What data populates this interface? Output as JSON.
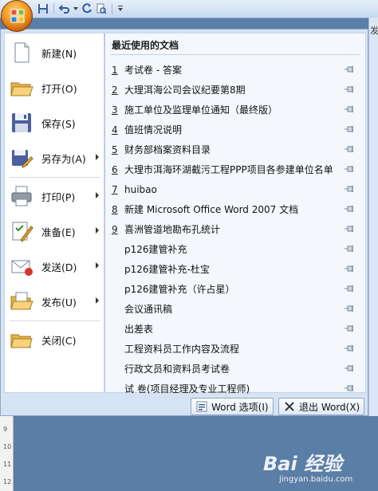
{
  "menu": {
    "commands": [
      {
        "label": "新建(N)",
        "icon": "new-document-icon",
        "submenu": false
      },
      {
        "label": "打开(O)",
        "icon": "open-folder-icon",
        "submenu": false
      },
      {
        "label": "保存(S)",
        "icon": "save-disk-icon",
        "submenu": false
      },
      {
        "label": "另存为(A)",
        "icon": "save-as-icon",
        "submenu": true
      },
      {
        "label": "打印(P)",
        "icon": "printer-icon",
        "submenu": true
      },
      {
        "label": "准备(E)",
        "icon": "prepare-icon",
        "submenu": true
      },
      {
        "label": "发送(D)",
        "icon": "send-icon",
        "submenu": true
      },
      {
        "label": "发布(U)",
        "icon": "publish-icon",
        "submenu": true
      },
      {
        "label": "关闭(C)",
        "icon": "close-folder-icon",
        "submenu": false
      }
    ],
    "recent_title": "最近使用的文档",
    "recent": [
      {
        "num": "1",
        "name": "考试卷 - 答案"
      },
      {
        "num": "2",
        "name": "大理洱海公司会议纪要第8期"
      },
      {
        "num": "3",
        "name": "施工单位及监理单位通知（最终版）"
      },
      {
        "num": "4",
        "name": "值班情况说明"
      },
      {
        "num": "5",
        "name": "财务部档案资料目录"
      },
      {
        "num": "6",
        "name": "大理市洱海环湖截污工程PPP项目各参建单位名单"
      },
      {
        "num": "7",
        "name": "huibao"
      },
      {
        "num": "8",
        "name": "新建 Microsoft Office Word 2007 文档"
      },
      {
        "num": "9",
        "name": "喜洲管道地勘布孔统计"
      },
      {
        "num": "",
        "name": "p126建管补充"
      },
      {
        "num": "",
        "name": "p126建管补充-杜宝"
      },
      {
        "num": "",
        "name": "p126建管补充（许占星）"
      },
      {
        "num": "",
        "name": "会议通讯稿"
      },
      {
        "num": "",
        "name": "出差表"
      },
      {
        "num": "",
        "name": "工程资料员工作内容及流程"
      },
      {
        "num": "",
        "name": "行政文员和资料员考试卷"
      },
      {
        "num": "",
        "name": "试    卷(项目经理及专业工程师)"
      }
    ],
    "word_options_label": "Word 选项(I)",
    "exit_word_label": "退出 Word(X)"
  },
  "ribbon_edge_text": "发",
  "ruler_ticks": [
    "9",
    "10",
    "11",
    "12"
  ],
  "watermark": {
    "big": "Bai 经验",
    "small": "jingyan.baidu.com"
  },
  "colors": {
    "accent": "#f39a24",
    "menu_bg": "#d6e3f3",
    "doc_bg": "#5b7ea6"
  }
}
